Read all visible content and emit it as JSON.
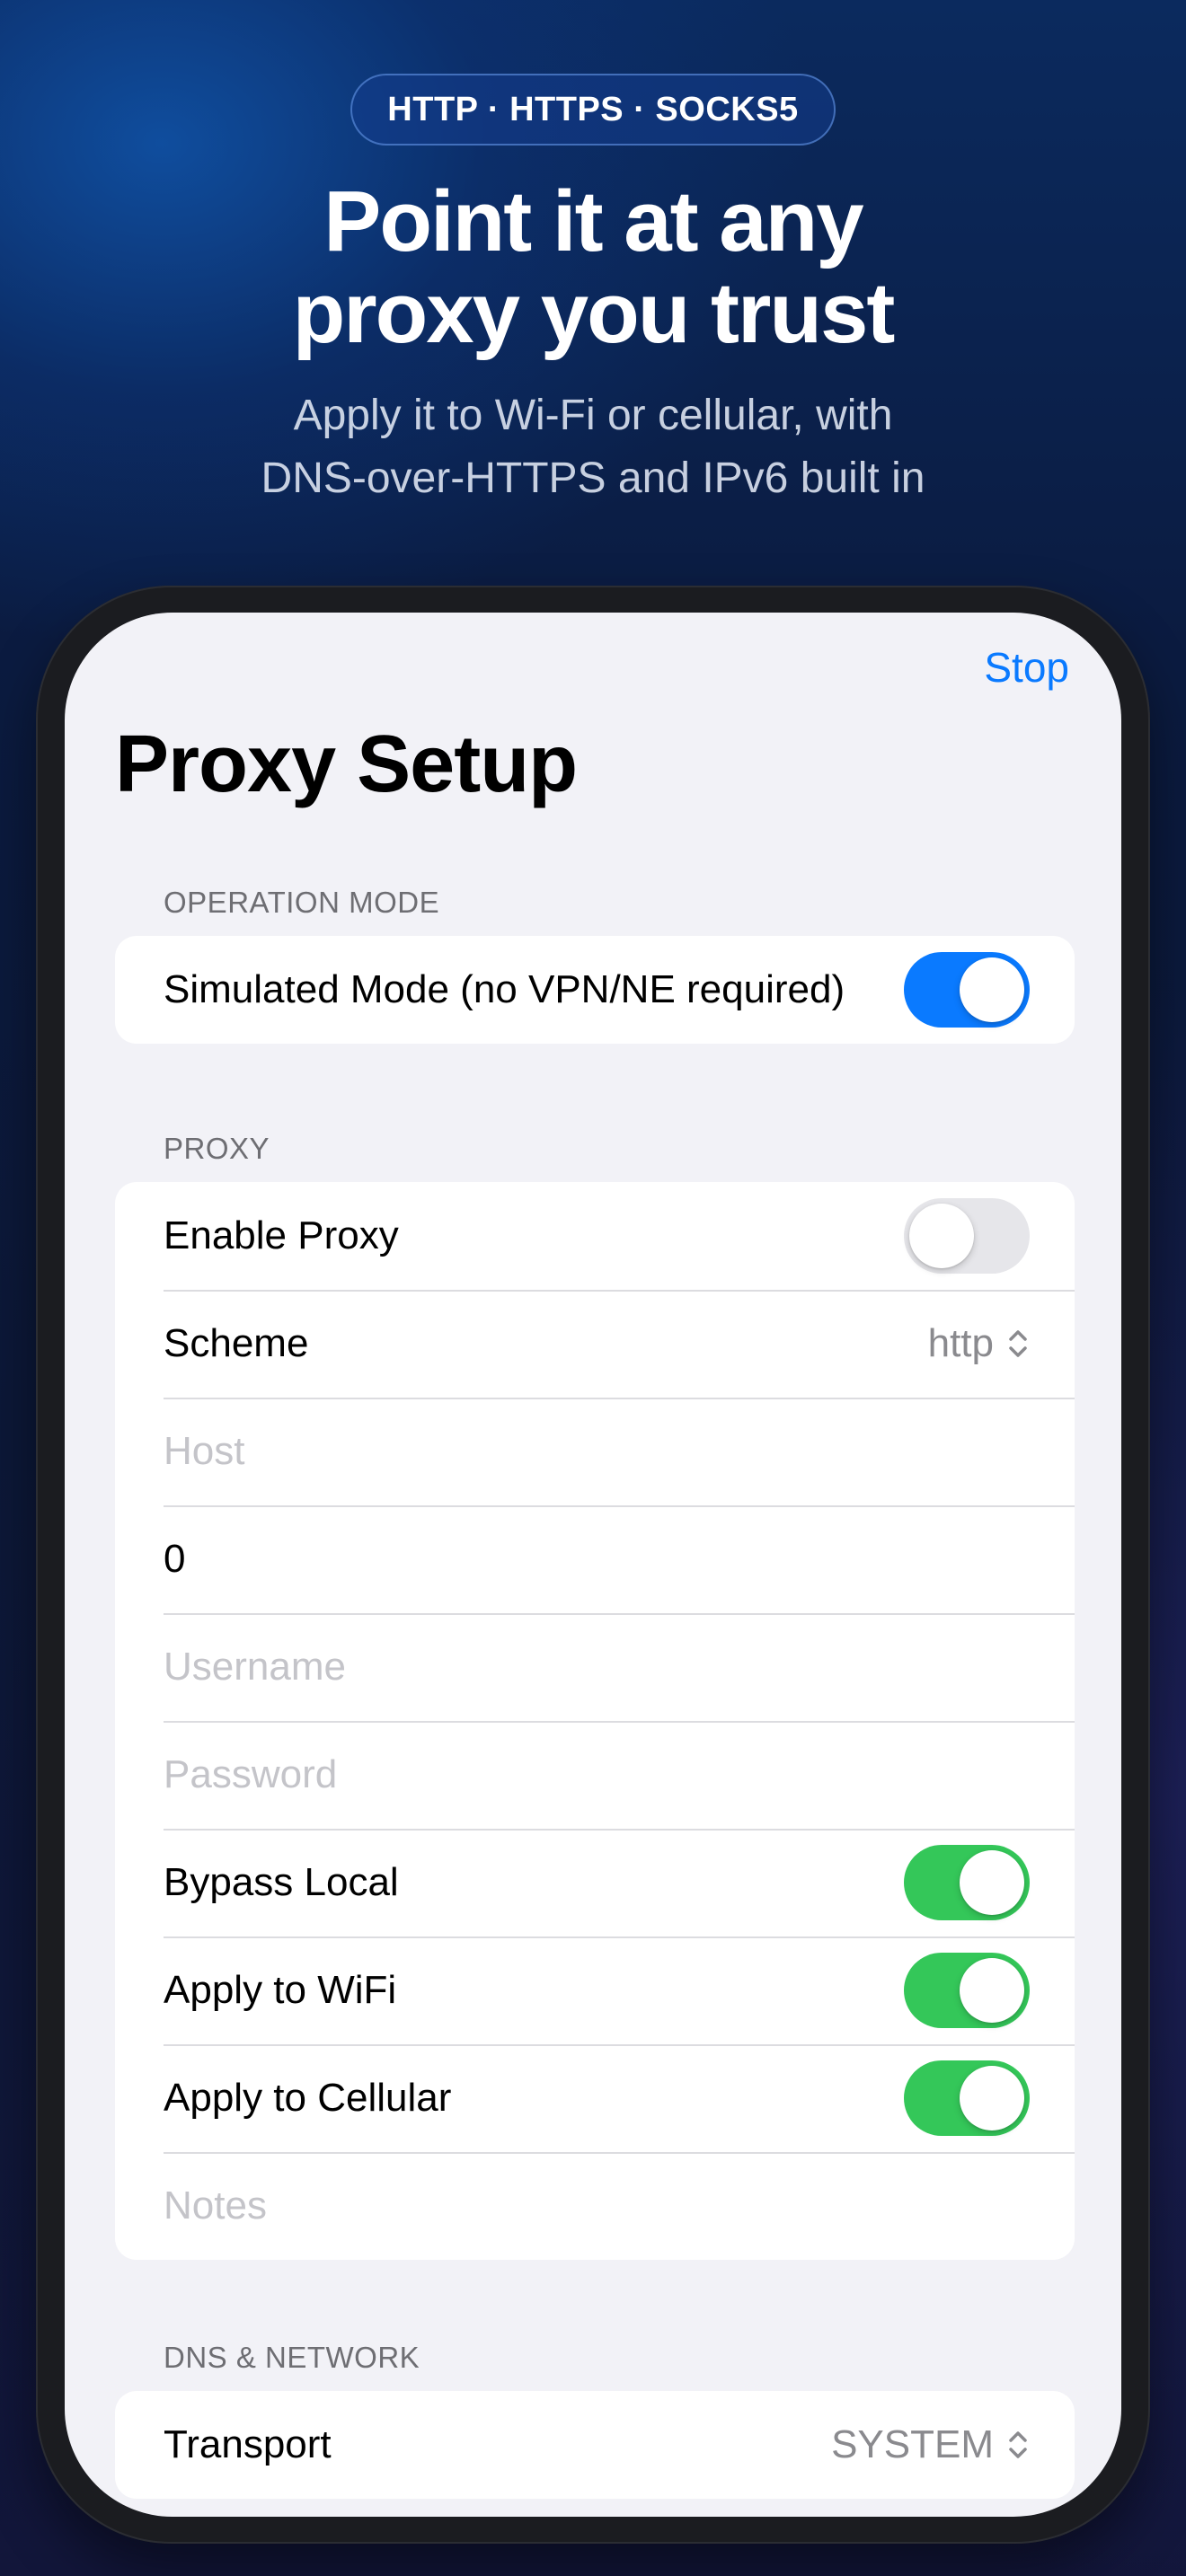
{
  "hero": {
    "pill": "HTTP · HTTPS · SOCKS5",
    "headline_line1": "Point it at any",
    "headline_line2": "proxy you trust",
    "subhead_line1": "Apply it to Wi-Fi or cellular, with",
    "subhead_line2": "DNS-over-HTTPS and IPv6 built in"
  },
  "nav": {
    "stop_label": "Stop",
    "title": "Proxy Setup"
  },
  "sections": {
    "operation_mode": {
      "header": "OPERATION MODE",
      "simulated_label": "Simulated Mode (no VPN/NE required)",
      "simulated_on": true
    },
    "proxy": {
      "header": "PROXY",
      "enable_label": "Enable Proxy",
      "enable_on": false,
      "scheme_label": "Scheme",
      "scheme_value": "http",
      "host_placeholder": "Host",
      "port_value": "0",
      "username_placeholder": "Username",
      "password_placeholder": "Password",
      "bypass_label": "Bypass Local",
      "bypass_on": true,
      "wifi_label": "Apply to WiFi",
      "wifi_on": true,
      "cellular_label": "Apply to Cellular",
      "cellular_on": true,
      "notes_placeholder": "Notes"
    },
    "dns": {
      "header": "DNS & NETWORK",
      "transport_label": "Transport",
      "transport_value": "SYSTEM"
    }
  },
  "colors": {
    "accent_blue": "#0a7aff",
    "toggle_green": "#34c759",
    "toggle_off": "#e6e6ea"
  }
}
